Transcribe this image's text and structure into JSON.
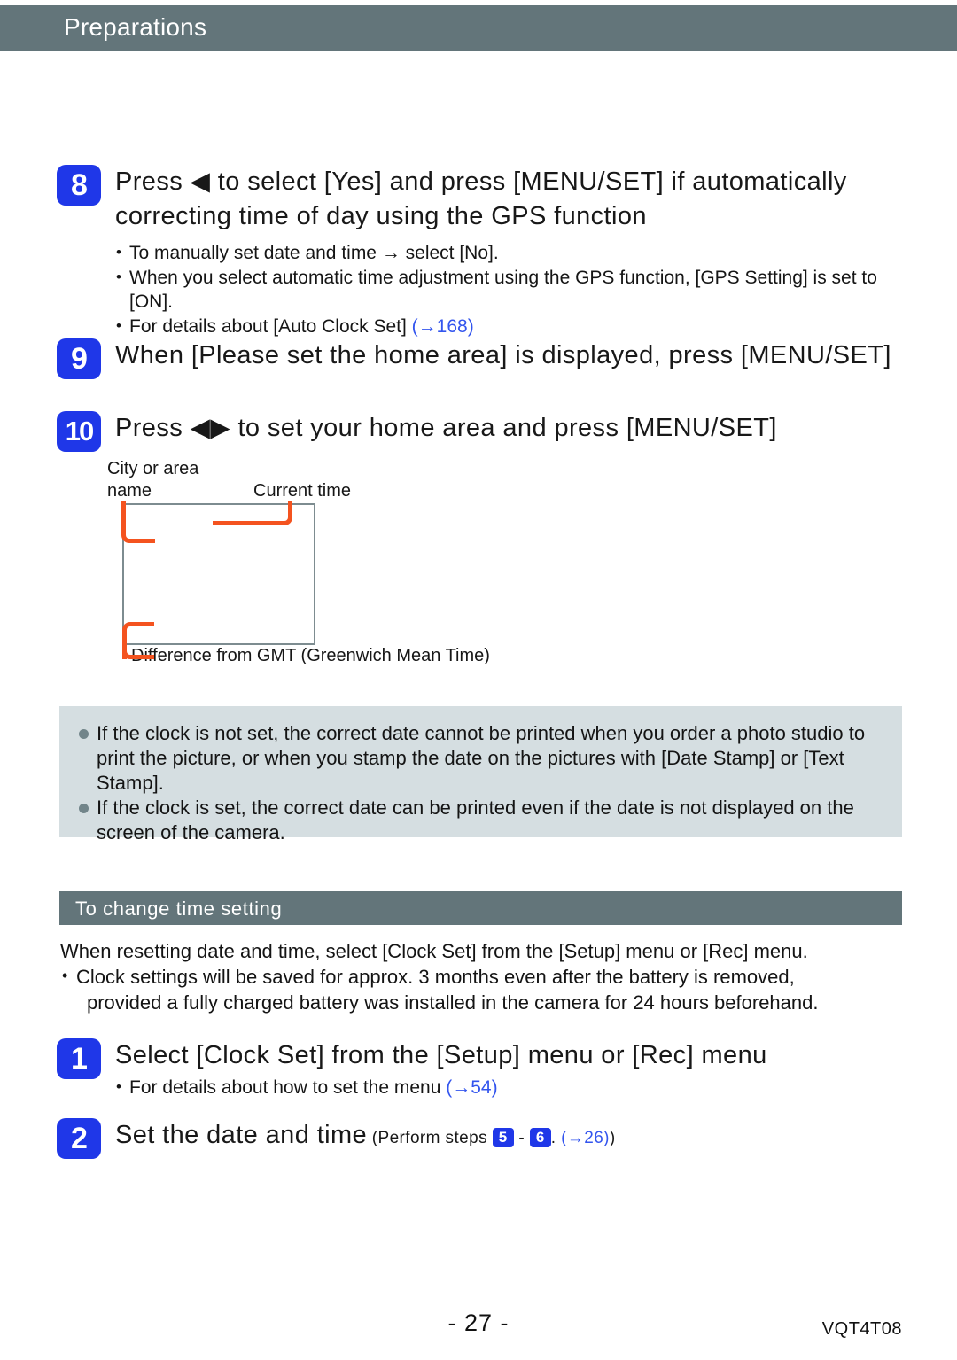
{
  "header": {
    "title": "Preparations"
  },
  "steps": [
    {
      "number": "8",
      "title": "Press ◀ to select [Yes] and press [MENU/SET] if automatically correcting time of day using the GPS function",
      "bullets": [
        {
          "text": "To manually set date and time → select [No].",
          "xref": ""
        },
        {
          "text": "When you select automatic time adjustment using the GPS function, [GPS Setting] is set to [ON].",
          "xref": ""
        },
        {
          "text": "For details about [Auto Clock Set] ",
          "xref": "(→168)"
        }
      ]
    },
    {
      "number": "9",
      "title": "When [Please set the home area] is displayed, press [MENU/SET]",
      "bullets": []
    },
    {
      "number": "10",
      "title": "Press ◀▶ to set your home area and press [MENU/SET]",
      "bullets": []
    }
  ],
  "diagram": {
    "label_city": "City or area\nname",
    "label_current_time": "Current time",
    "label_gmt": "Difference from GMT (Greenwich Mean Time)",
    "leader_color": "#f4531f",
    "screen_border_color": "#7d8c90"
  },
  "note_panel": {
    "background": "#d5dee1",
    "bullet_color": "#72858a",
    "items": [
      "If the clock is not set, the correct date cannot be printed when you order a photo studio to print the picture, or when you stamp the date on the pictures with [Date Stamp] or [Text Stamp].",
      "If the clock is set, the correct date can be printed even if the date is not displayed on the screen of the camera."
    ]
  },
  "section": {
    "bar_title": "To change time setting",
    "bar_color": "#63757a",
    "intro": "When resetting date and time, select [Clock Set] from the [Setup] menu or [Rec] menu.",
    "bullet_line1": "Clock settings will be saved for approx. 3 months even after the battery is removed,",
    "bullet_line2": "provided a fully charged battery was installed in the camera for 24 hours beforehand."
  },
  "change_steps": [
    {
      "number": "1",
      "title": "Select [Clock Set] from the [Setup] menu or [Rec] menu",
      "bullet_text": "For details about how to set the menu ",
      "bullet_xref": "(→54)"
    },
    {
      "number": "2",
      "title": "Set the date and time",
      "note_open": "(Perform steps ",
      "note_badge_a": "5",
      "note_dash": " - ",
      "note_badge_b": "6",
      "note_mid": ". ",
      "note_xref": "(→26)",
      "note_close": ")"
    }
  ],
  "footer": {
    "page_number": "- 27 -",
    "doc_code": "VQT4T08"
  },
  "colors": {
    "header_bar": "#63757a",
    "step_badge": "#1f37e8",
    "xref_link": "#3355ee"
  }
}
